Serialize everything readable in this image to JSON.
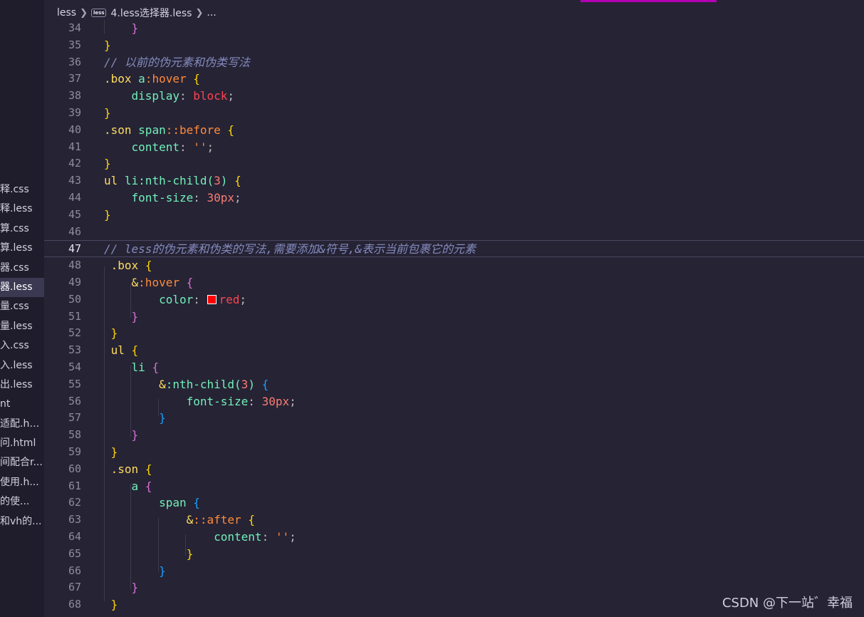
{
  "breadcrumb": {
    "folder": "less",
    "file_badge": "less",
    "file": "4.less选择器.less",
    "more": "..."
  },
  "sidebar": {
    "items": [
      {
        "label": "释.css",
        "active": false
      },
      {
        "label": "释.less",
        "active": false
      },
      {
        "label": "算.css",
        "active": false
      },
      {
        "label": "算.less",
        "active": false
      },
      {
        "label": "器.css",
        "active": false
      },
      {
        "label": "器.less",
        "active": true
      },
      {
        "label": "量.css",
        "active": false
      },
      {
        "label": "量.less",
        "active": false
      },
      {
        "label": "入.css",
        "active": false
      },
      {
        "label": "入.less",
        "active": false
      },
      {
        "label": "出.less",
        "active": false
      },
      {
        "label": "nt",
        "active": false
      },
      {
        "label": "适配.html",
        "active": false
      },
      {
        "label": "问.html",
        "active": false
      },
      {
        "label": "间配合r...",
        "active": false
      },
      {
        "label": "使用.h...",
        "active": false
      },
      {
        "label": "的使...",
        "active": false
      },
      {
        "label": "和vh的...",
        "active": false
      }
    ]
  },
  "editor": {
    "current_line": 47,
    "lines": [
      {
        "n": 34
      },
      {
        "n": 35
      },
      {
        "n": 36
      },
      {
        "n": 37
      },
      {
        "n": 38
      },
      {
        "n": 39
      },
      {
        "n": 40
      },
      {
        "n": 41
      },
      {
        "n": 42
      },
      {
        "n": 43
      },
      {
        "n": 44
      },
      {
        "n": 45
      },
      {
        "n": 46
      },
      {
        "n": 47
      },
      {
        "n": 48
      },
      {
        "n": 49
      },
      {
        "n": 50
      },
      {
        "n": 51
      },
      {
        "n": 52
      },
      {
        "n": 53
      },
      {
        "n": 54
      },
      {
        "n": 55
      },
      {
        "n": 56
      },
      {
        "n": 57
      },
      {
        "n": 58
      },
      {
        "n": 59
      },
      {
        "n": 60
      },
      {
        "n": 61
      },
      {
        "n": 62
      },
      {
        "n": 63
      },
      {
        "n": 64
      },
      {
        "n": 65
      },
      {
        "n": 66
      },
      {
        "n": 67
      },
      {
        "n": 68
      }
    ],
    "code": {
      "l34": "}",
      "l35": "}",
      "l36": "// 以前的伪元素和伪类写法",
      "l37_sel": ".box",
      "l37_tag": "a",
      "l37_pseudo": ":hover",
      "l38_prop": "display",
      "l38_val": "block",
      "l40_sel": ".son",
      "l40_tag": "span",
      "l40_pseudo": "::before",
      "l41_prop": "content",
      "l41_val": "''",
      "l43_tag1": "ul",
      "l43_tag2": "li",
      "l43_pseudo": ":nth-child(",
      "l43_num": "3",
      "l43_close": ")",
      "l44_prop": "font-size",
      "l44_val": "30px",
      "l47": "// less的伪元素和伪类的写法,需要添加&符号,&表示当前包裹它的元素",
      "l48_sel": ".box",
      "l49_pseudo": ":hover",
      "l50_prop": "color",
      "l50_val": "red",
      "l53_tag": "ul",
      "l54_tag": "li",
      "l55_pseudo": ":nth-child(",
      "l55_num": "3",
      "l55_close": ")",
      "l56_prop": "font-size",
      "l56_val": "30px",
      "l60_sel": ".son",
      "l61_tag": "a",
      "l62_tag": "span",
      "l63_pseudo": "::after",
      "l64_prop": "content",
      "l64_val": "''"
    },
    "colors": {
      "background": "#262335",
      "selector": "#fede5d",
      "tag": "#72f1b8",
      "pseudo": "#ff8b39",
      "value": "#fe4450",
      "number": "#f97e72",
      "comment": "#848bbd",
      "bracket_level1": "#ffd700",
      "bracket_level2": "#da70d6",
      "bracket_level3": "#179fff",
      "swatch_red": "#ff0000"
    }
  },
  "watermark": "CSDN @下一站゛幸福"
}
